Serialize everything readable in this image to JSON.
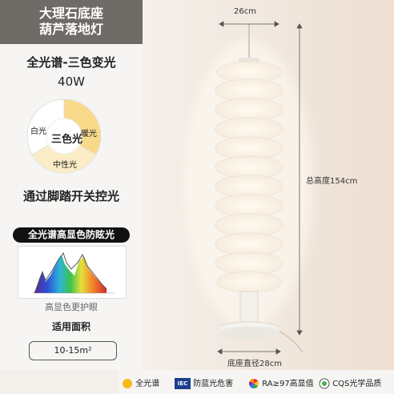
{
  "title": {
    "line1": "大理石底座",
    "line2": "葫芦落地灯"
  },
  "spec": {
    "spectrum_label": "全光谱-三色变光",
    "wattage": "40W"
  },
  "color_modes": {
    "center": "三色光",
    "white": "白光",
    "warm": "暖光",
    "neutral": "中性光",
    "colors": {
      "white": "#ffffff",
      "warm": "#f9d98a",
      "neutral": "#fbeec7"
    }
  },
  "pedal_text": "通过脚踏开关控光",
  "badge_text": "全光谱高显色防眩光",
  "spectrum_caption": "高显色更护眼",
  "area": {
    "label": "适用面积",
    "value": "10-15m²"
  },
  "dimensions": {
    "top_width": "26cm",
    "height": "总高度154cm",
    "base": "底座直径28cm"
  },
  "bottom_bar": [
    {
      "icon": "sun-icon",
      "text": "全光谱"
    },
    {
      "icon": "iec-logo-icon",
      "logo_text": "IEC",
      "text": "防蓝光危害"
    },
    {
      "icon": "color-wheel-icon",
      "text": "RA≥97高显值"
    },
    {
      "icon": "cqs-globe-icon",
      "text": "CQS光学品质"
    }
  ]
}
